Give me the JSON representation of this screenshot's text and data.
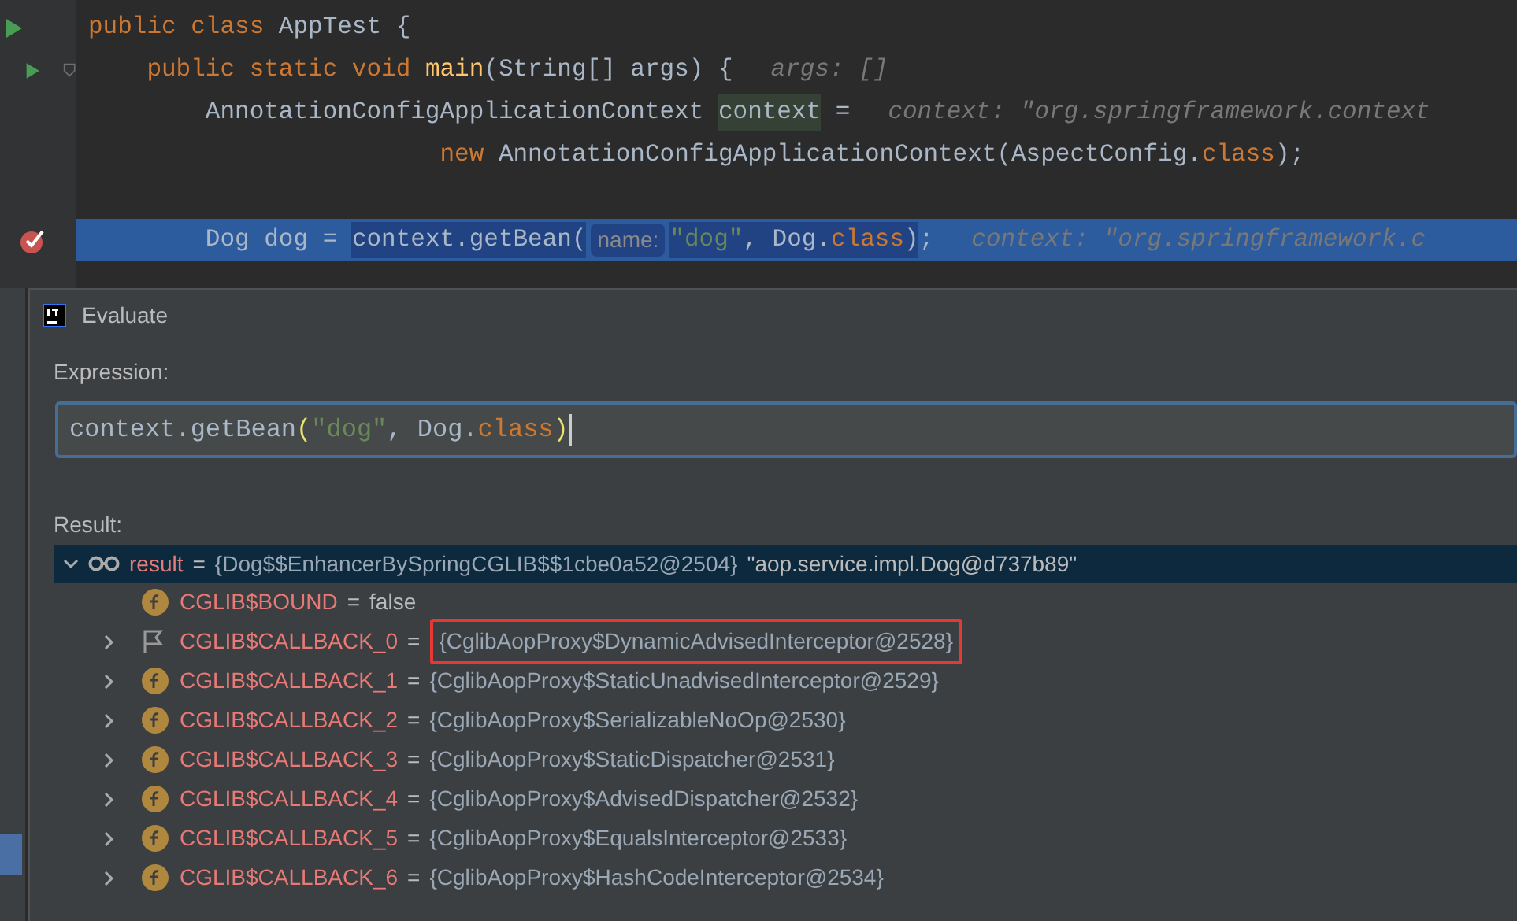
{
  "editor": {
    "lines": [
      {
        "kind": "runnable",
        "tokens": [
          {
            "kind": "keyword",
            "text": "public class "
          },
          {
            "kind": "plain",
            "text": "AppTest {"
          }
        ]
      },
      {
        "kind": "method",
        "tokens": [
          {
            "kind": "keyword",
            "text": "    public static void "
          },
          {
            "kind": "method",
            "text": "main"
          },
          {
            "kind": "plain",
            "text": "(String[] args) {"
          },
          {
            "kind": "hint",
            "text": "args: []"
          }
        ]
      },
      {
        "kind": "plain",
        "tokens": [
          {
            "kind": "plain",
            "text": "        AnnotationConfigApplicationContext "
          },
          {
            "kind": "var",
            "text": "context"
          },
          {
            "kind": "plain",
            "text": " ="
          },
          {
            "kind": "hint",
            "text": "context: \"org.springframework.context"
          }
        ]
      },
      {
        "kind": "plain",
        "tokens": [
          {
            "kind": "keyword",
            "text": "                        new "
          },
          {
            "kind": "plain",
            "text": "AnnotationConfigApplicationContext(AspectConfig."
          },
          {
            "kind": "keyword",
            "text": "class"
          },
          {
            "kind": "plain",
            "text": ");"
          }
        ]
      },
      {
        "kind": "blank"
      },
      {
        "kind": "breakpoint",
        "tokens": [
          {
            "kind": "plain",
            "text": "        Dog dog = ",
            "selected": false
          },
          {
            "kind": "plain",
            "text": "context.getBean(",
            "selected": true
          },
          {
            "kind": "param",
            "text": "name:",
            "selected": true
          },
          {
            "kind": "string",
            "text": "\"dog\"",
            "selected": true
          },
          {
            "kind": "plain",
            "text": ", Dog.",
            "selected": true
          },
          {
            "kind": "keyword",
            "text": "class",
            "selected": true
          },
          {
            "kind": "plain",
            "text": ")",
            "selected": true
          },
          {
            "kind": "plain",
            "text": ";",
            "selected": false
          },
          {
            "kind": "hint",
            "text": "context: \"org.springframework.c",
            "selected": false
          }
        ]
      }
    ]
  },
  "dialog": {
    "title": "Evaluate",
    "expression_label": "Expression:",
    "expression": [
      {
        "kind": "plain",
        "text": "context.getBean"
      },
      {
        "kind": "paren",
        "text": "("
      },
      {
        "kind": "string",
        "text": "\"dog\""
      },
      {
        "kind": "plain",
        "text": ", Dog."
      },
      {
        "kind": "keyword",
        "text": "class"
      },
      {
        "kind": "paren",
        "text": ")"
      }
    ],
    "result_label": "Result:",
    "tree": {
      "kind": "watch",
      "name": "result",
      "operator": "=",
      "value": "{Dog$$EnhancerBySpringCGLIB$$1cbe0a52@2504}",
      "detail": "\"aop.service.impl.Dog@d737b89\"",
      "expanded": true,
      "selected": true,
      "children": [
        {
          "kind": "field",
          "name": "CGLIB$BOUND",
          "operator": "=",
          "value": "false",
          "expandable": false,
          "highlighted": false
        },
        {
          "kind": "flag",
          "name": "CGLIB$CALLBACK_0",
          "operator": "=",
          "value": "{CglibAopProxy$DynamicAdvisedInterceptor@2528}",
          "expandable": true,
          "highlighted": true
        },
        {
          "kind": "field",
          "name": "CGLIB$CALLBACK_1",
          "operator": "=",
          "value": "{CglibAopProxy$StaticUnadvisedInterceptor@2529}",
          "expandable": true,
          "highlighted": false
        },
        {
          "kind": "field",
          "name": "CGLIB$CALLBACK_2",
          "operator": "=",
          "value": "{CglibAopProxy$SerializableNoOp@2530}",
          "expandable": true,
          "highlighted": false
        },
        {
          "kind": "field",
          "name": "CGLIB$CALLBACK_3",
          "operator": "=",
          "value": "{CglibAopProxy$StaticDispatcher@2531}",
          "expandable": true,
          "highlighted": false
        },
        {
          "kind": "field",
          "name": "CGLIB$CALLBACK_4",
          "operator": "=",
          "value": "{CglibAopProxy$AdvisedDispatcher@2532}",
          "expandable": true,
          "highlighted": false
        },
        {
          "kind": "field",
          "name": "CGLIB$CALLBACK_5",
          "operator": "=",
          "value": "{CglibAopProxy$EqualsInterceptor@2533}",
          "expandable": true,
          "highlighted": false
        },
        {
          "kind": "field",
          "name": "CGLIB$CALLBACK_6",
          "operator": "=",
          "value": "{CglibAopProxy$HashCodeInterceptor@2534}",
          "expandable": true,
          "highlighted": false
        }
      ]
    }
  }
}
